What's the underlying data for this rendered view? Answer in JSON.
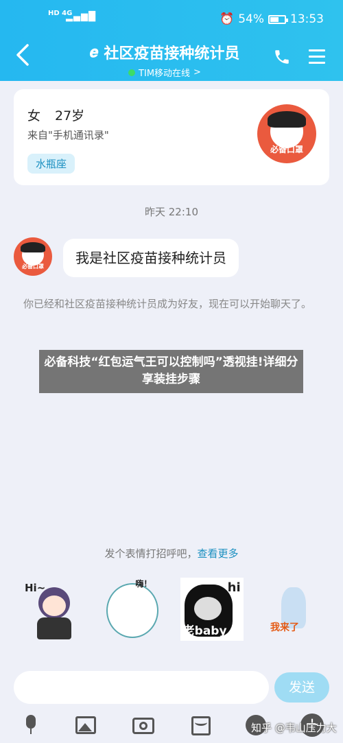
{
  "status_bar": {
    "network_left": "HD 4G",
    "network_right": "4G",
    "battery": "54%",
    "time": "13:53"
  },
  "header": {
    "title": "社区疫苗接种统计员",
    "subtitle": "TIM移动在线",
    "subtitle_arrow": ">"
  },
  "profile": {
    "gender": "女",
    "age": "27岁",
    "source": "来自\"手机通讯录\"",
    "tag": "水瓶座",
    "avatar_text": "必备口罩"
  },
  "chat": {
    "timestamp": "昨天 22:10",
    "message": "我是社区疫苗接种统计员",
    "notice": "你已经和社区疫苗接种统计员成为好友，现在可以开始聊天了。"
  },
  "overlay_text": "必备科技“红包运气王可以控制吗”透视挂!详细分享装挂步骤",
  "stickers": {
    "prompt": "发个表情打招呼吧，",
    "more_link": "查看更多",
    "items": [
      {
        "label": "Hi~"
      },
      {
        "label": "嗨！"
      },
      {
        "label": "老baby",
        "extra": "hi"
      },
      {
        "label": "我来了"
      }
    ]
  },
  "composer": {
    "send_label": "发送"
  },
  "watermark": "知乎 @韦山压力大",
  "colors": {
    "header_bg": "#2fc2ee",
    "avatar_bg": "#ea5a3e",
    "send_bg": "#9fdcf4",
    "online_dot": "#3ddc67"
  }
}
